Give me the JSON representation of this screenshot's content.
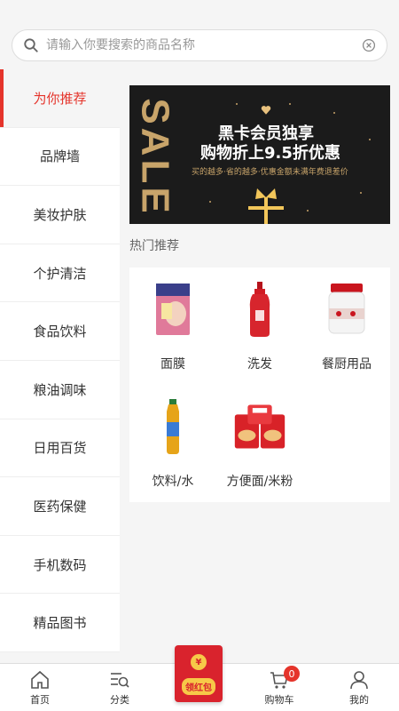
{
  "search": {
    "placeholder": "请输入你要搜索的商品名称"
  },
  "sidebar": {
    "items": [
      {
        "label": "为你推荐",
        "active": true
      },
      {
        "label": "品牌墙"
      },
      {
        "label": "美妆护肤"
      },
      {
        "label": "个护清洁"
      },
      {
        "label": "食品饮料"
      },
      {
        "label": "粮油调味"
      },
      {
        "label": "日用百货"
      },
      {
        "label": "医药保健"
      },
      {
        "label": "手机数码"
      },
      {
        "label": "精品图书"
      }
    ]
  },
  "banner": {
    "sale_text": "SALE",
    "line1": "黑卡会员独享",
    "line2": "购物折上9.5折优惠",
    "line3": "买的越多·省的越多·优惠金额未满年费退差价"
  },
  "hot": {
    "title": "热门推荐",
    "items": [
      {
        "label": "面膜",
        "icon": "face-mask-icon"
      },
      {
        "label": "洗发",
        "icon": "shampoo-icon"
      },
      {
        "label": "餐厨用品",
        "icon": "food-jar-icon"
      },
      {
        "label": "饮料/水",
        "icon": "drink-bottle-icon"
      },
      {
        "label": "方便面/米粉",
        "icon": "instant-noodle-icon"
      }
    ]
  },
  "nav": {
    "home": "首页",
    "category": "分类",
    "red_envelope": "领红包",
    "cart": "购物车",
    "cart_count": "0",
    "me": "我的"
  },
  "colors": {
    "accent": "#e5342b",
    "gold": "#c8a46a"
  }
}
